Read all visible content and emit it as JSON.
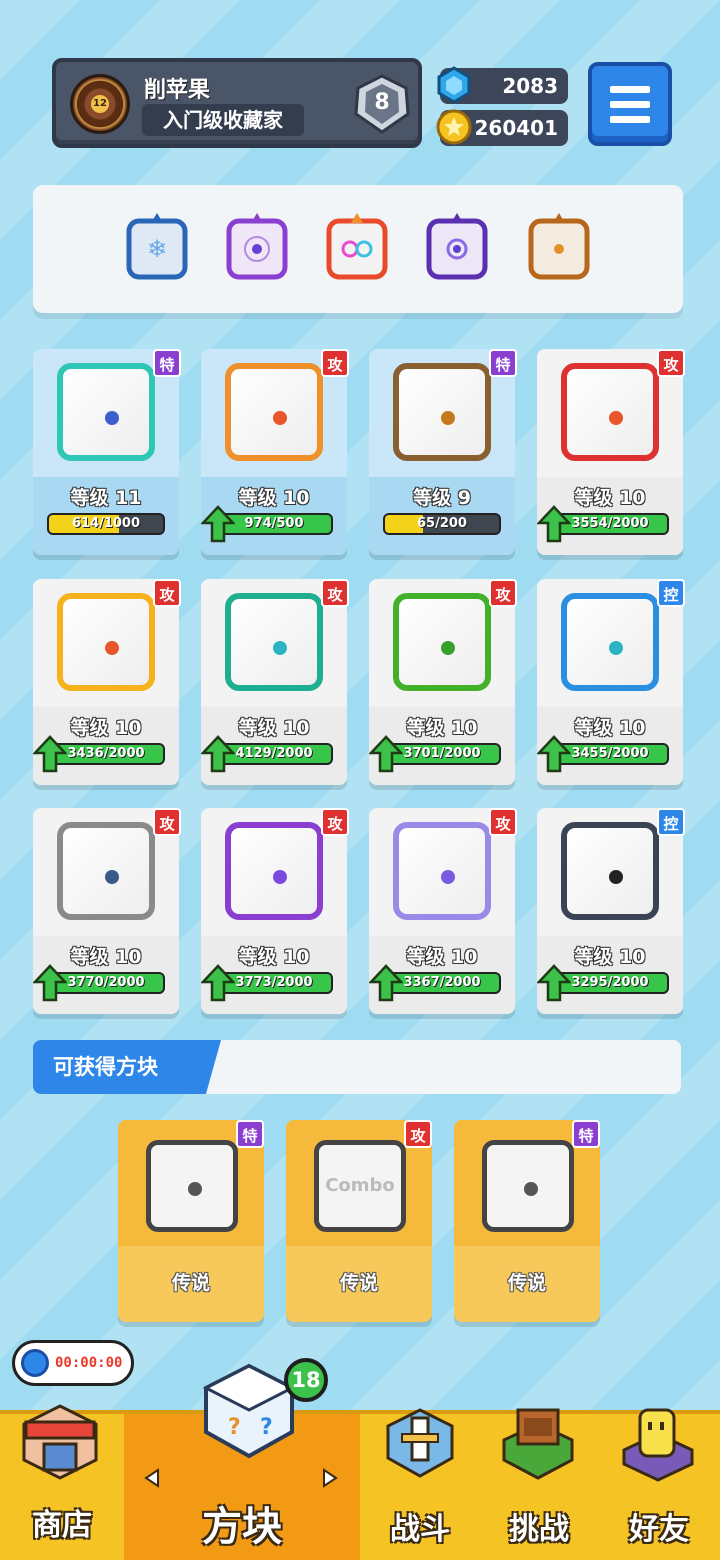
{
  "player": {
    "name": "削苹果",
    "title": "入门级收藏家",
    "avatar_level": "12",
    "rank": "8"
  },
  "currency": {
    "gems": "2083",
    "coins": "260401"
  },
  "deck": {
    "slots": [
      "ice-dice",
      "arcane-dice",
      "rainbow-dice",
      "gravity-dice",
      "earth-dice"
    ]
  },
  "dice": [
    {
      "level_label": "等级 11",
      "progress": "614/1000",
      "tag": "特",
      "tag_color": "#8a3fd1",
      "upgradable": false,
      "highlighted": true,
      "fill_fraction": 0.61,
      "fill_color": "#f4d21a",
      "face_color": "#2ec7b5",
      "pip_color": "#3a5fcf"
    },
    {
      "level_label": "等级 10",
      "progress": "974/500",
      "tag": "攻",
      "tag_color": "#e03131",
      "upgradable": true,
      "highlighted": true,
      "fill_fraction": 1,
      "fill_color": "#37c54a",
      "face_color": "#f0902b",
      "pip_color": "#e8562d"
    },
    {
      "level_label": "等级 9",
      "progress": "65/200",
      "tag": "特",
      "tag_color": "#8a3fd1",
      "upgradable": false,
      "highlighted": true,
      "fill_fraction": 0.33,
      "fill_color": "#f4d21a",
      "face_color": "#8a6030",
      "pip_color": "#c47a1c"
    },
    {
      "level_label": "等级 10",
      "progress": "3554/2000",
      "tag": "攻",
      "tag_color": "#e03131",
      "upgradable": true,
      "highlighted": false,
      "fill_fraction": 1,
      "fill_color": "#37c54a",
      "face_color": "#e03131",
      "pip_color": "#e8562d"
    },
    {
      "level_label": "等级 10",
      "progress": "3436/2000",
      "tag": "攻",
      "tag_color": "#e03131",
      "upgradable": true,
      "highlighted": false,
      "fill_fraction": 1,
      "fill_color": "#37c54a",
      "face_color": "#f5b21c",
      "pip_color": "#e8562d"
    },
    {
      "level_label": "等级 10",
      "progress": "4129/2000",
      "tag": "攻",
      "tag_color": "#e03131",
      "upgradable": true,
      "highlighted": false,
      "fill_fraction": 1,
      "fill_color": "#37c54a",
      "face_color": "#1fae90",
      "pip_color": "#2bb3c0"
    },
    {
      "level_label": "等级 10",
      "progress": "3701/2000",
      "tag": "攻",
      "tag_color": "#e03131",
      "upgradable": true,
      "highlighted": false,
      "fill_fraction": 1,
      "fill_color": "#37c54a",
      "face_color": "#43b02a",
      "pip_color": "#37a02a"
    },
    {
      "level_label": "等级 10",
      "progress": "3455/2000",
      "tag": "控",
      "tag_color": "#2f86e9",
      "upgradable": true,
      "highlighted": false,
      "fill_fraction": 1,
      "fill_color": "#37c54a",
      "face_color": "#2a8fe0",
      "pip_color": "#2bb3c0"
    },
    {
      "level_label": "等级 10",
      "progress": "3770/2000",
      "tag": "攻",
      "tag_color": "#e03131",
      "upgradable": true,
      "highlighted": false,
      "fill_fraction": 1,
      "fill_color": "#37c54a",
      "face_color": "#8a8a8a",
      "pip_color": "#3a5a8a"
    },
    {
      "level_label": "等级 10",
      "progress": "3773/2000",
      "tag": "攻",
      "tag_color": "#e03131",
      "upgradable": true,
      "highlighted": false,
      "fill_fraction": 1,
      "fill_color": "#37c54a",
      "face_color": "#8a3fd1",
      "pip_color": "#7a4ae0"
    },
    {
      "level_label": "等级 10",
      "progress": "3367/2000",
      "tag": "攻",
      "tag_color": "#e03131",
      "upgradable": true,
      "highlighted": false,
      "fill_fraction": 1,
      "fill_color": "#37c54a",
      "face_color": "#9a8ae8",
      "pip_color": "#7a5ae0"
    },
    {
      "level_label": "等级 10",
      "progress": "3295/2000",
      "tag": "控",
      "tag_color": "#2f86e9",
      "upgradable": true,
      "highlighted": false,
      "fill_fraction": 1,
      "fill_color": "#37c54a",
      "face_color": "#3a4454",
      "pip_color": "#222222"
    }
  ],
  "available": {
    "header": "可获得方块",
    "cards": [
      {
        "rarity": "传说",
        "tag": "特",
        "tag_color": "#8a3fd1"
      },
      {
        "rarity": "传说",
        "tag": "攻",
        "tag_color": "#e03131",
        "face_text": "Combo"
      },
      {
        "rarity": "传说",
        "tag": "特",
        "tag_color": "#8a3fd1"
      }
    ]
  },
  "timer": "00:00:00",
  "nav": {
    "badge": "18",
    "shop": "商店",
    "dice": "方块",
    "battle": "战斗",
    "challenge": "挑战",
    "friends": "好友"
  }
}
